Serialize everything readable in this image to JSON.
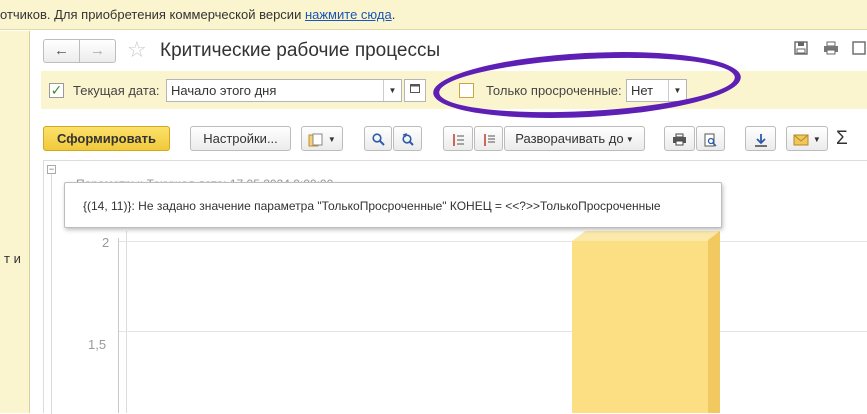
{
  "banner": {
    "text": "отчиков. Для приобретения коммерческой версии ",
    "link": "нажмите сюда",
    "tail": "."
  },
  "left_panel": {
    "fragment": "т и"
  },
  "window": {
    "title": "Критические рабочие процессы",
    "nav_back": "←",
    "nav_forward": "→",
    "star": "☆"
  },
  "params": {
    "current_date": {
      "checked": true,
      "label": "Текущая дата:",
      "value": "Начало этого дня"
    },
    "overdue_only": {
      "checked": false,
      "label": "Только просроченные:",
      "value": "Нет"
    }
  },
  "toolbar": {
    "generate": "Сформировать",
    "settings": "Настройки...",
    "expand_to": "Разворачивать до"
  },
  "report": {
    "header_fragment": "Параметры:  Текущая дата: 17.05.2024 0:00:00"
  },
  "tooltip": {
    "message": "{(14, 11)}: Не задано значение параметра \"ТолькоПросроченные\" КОНЕЦ = <<?>>ТолькоПросроченные"
  },
  "chart_data": {
    "type": "bar",
    "yticks": [
      "2",
      "1,5"
    ],
    "values": [
      2
    ]
  },
  "colors": {
    "banner_bg": "#fbf5cf",
    "primary_button": "#f1c93a",
    "annotation_circle": "#5e1fb5",
    "bar": "#fddf83",
    "link": "#1a56b5"
  }
}
